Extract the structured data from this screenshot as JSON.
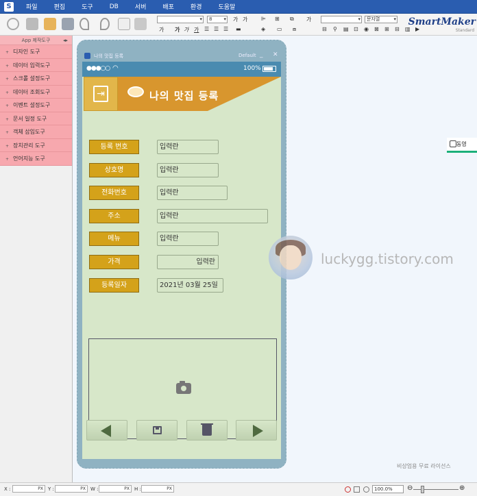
{
  "menu": {
    "items": [
      "파일",
      "편집",
      "도구",
      "DB",
      "서버",
      "배포",
      "환경",
      "도움말"
    ]
  },
  "toolbar": {
    "font_size": "8",
    "style_select": "문자열",
    "brand": "SmartMaker",
    "brand_sub": "Standard"
  },
  "left_panel": {
    "title": "App 제작도구",
    "items": [
      "디자인 도구",
      "데이터 입력도구",
      "스크롤 설정도구",
      "데이터 조회도구",
      "이벤트 설정도구",
      "문서 일정 도구",
      "객체 삽입도구",
      "장치관리 도구",
      "언어지능 도구"
    ]
  },
  "canvas": {
    "side_tab": "동영",
    "watermark": "luckygg.tistory.com",
    "license": "비상업용 무료 라이선스"
  },
  "phone": {
    "window_title": "나의 맛집 등록",
    "default_label": "Default",
    "battery_pct": "100%",
    "header_title": "나의 맛집 등록",
    "fields": [
      {
        "label": "등록 번호",
        "value": "입력란"
      },
      {
        "label": "상호명",
        "value": "입력란"
      },
      {
        "label": "전화번호",
        "value": "입력란"
      },
      {
        "label": "주소",
        "value": "입력란"
      },
      {
        "label": "메뉴",
        "value": "입력란"
      },
      {
        "label": "가격",
        "value": "입력란"
      },
      {
        "label": "등록일자",
        "value": "2021년 03월 25일"
      }
    ]
  },
  "statusbar": {
    "x_label": "X :",
    "y_label": "Y :",
    "w_label": "W :",
    "h_label": "H :",
    "unit": "PX",
    "zoom": "100.0%"
  }
}
